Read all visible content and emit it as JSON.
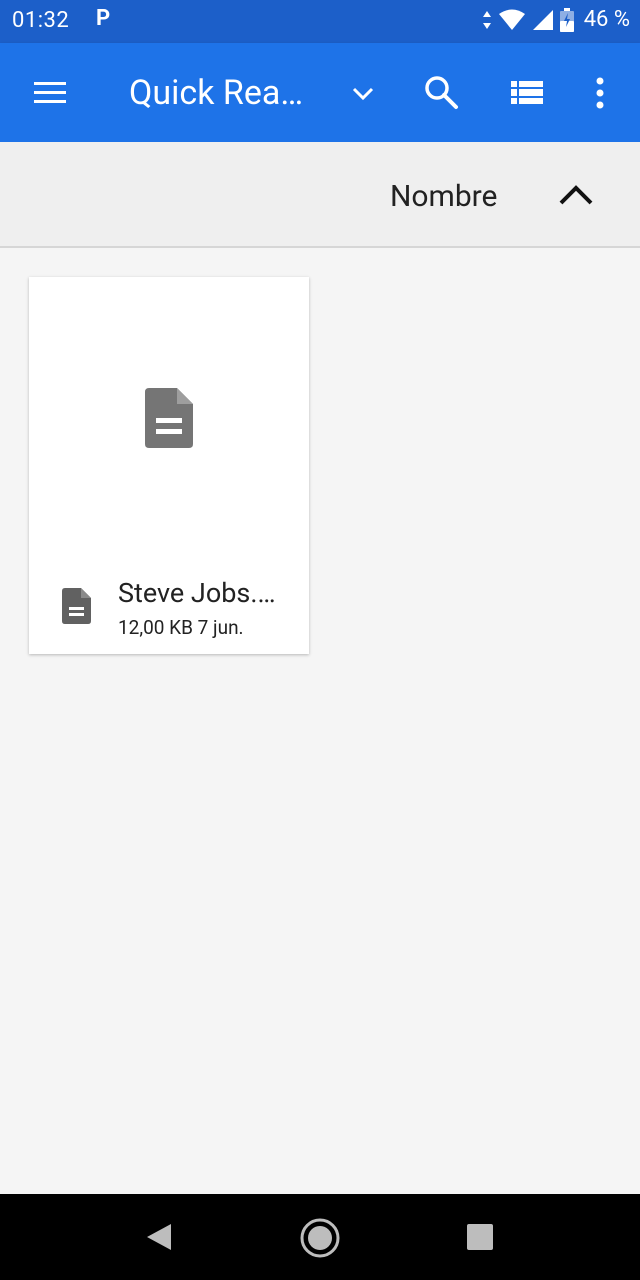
{
  "status_bar": {
    "time": "01:32",
    "notification": "P",
    "battery": "46 %"
  },
  "app_bar": {
    "title": "Quick Rea…"
  },
  "sort_bar": {
    "label": "Nombre"
  },
  "files": [
    {
      "name": "Steve Jobs.…",
      "size": "12,00 KB",
      "date": "7 jun."
    }
  ],
  "colors": {
    "status_bar": "#1c5fc9",
    "app_bar": "#1e73e8",
    "background": "#f5f5f5"
  }
}
